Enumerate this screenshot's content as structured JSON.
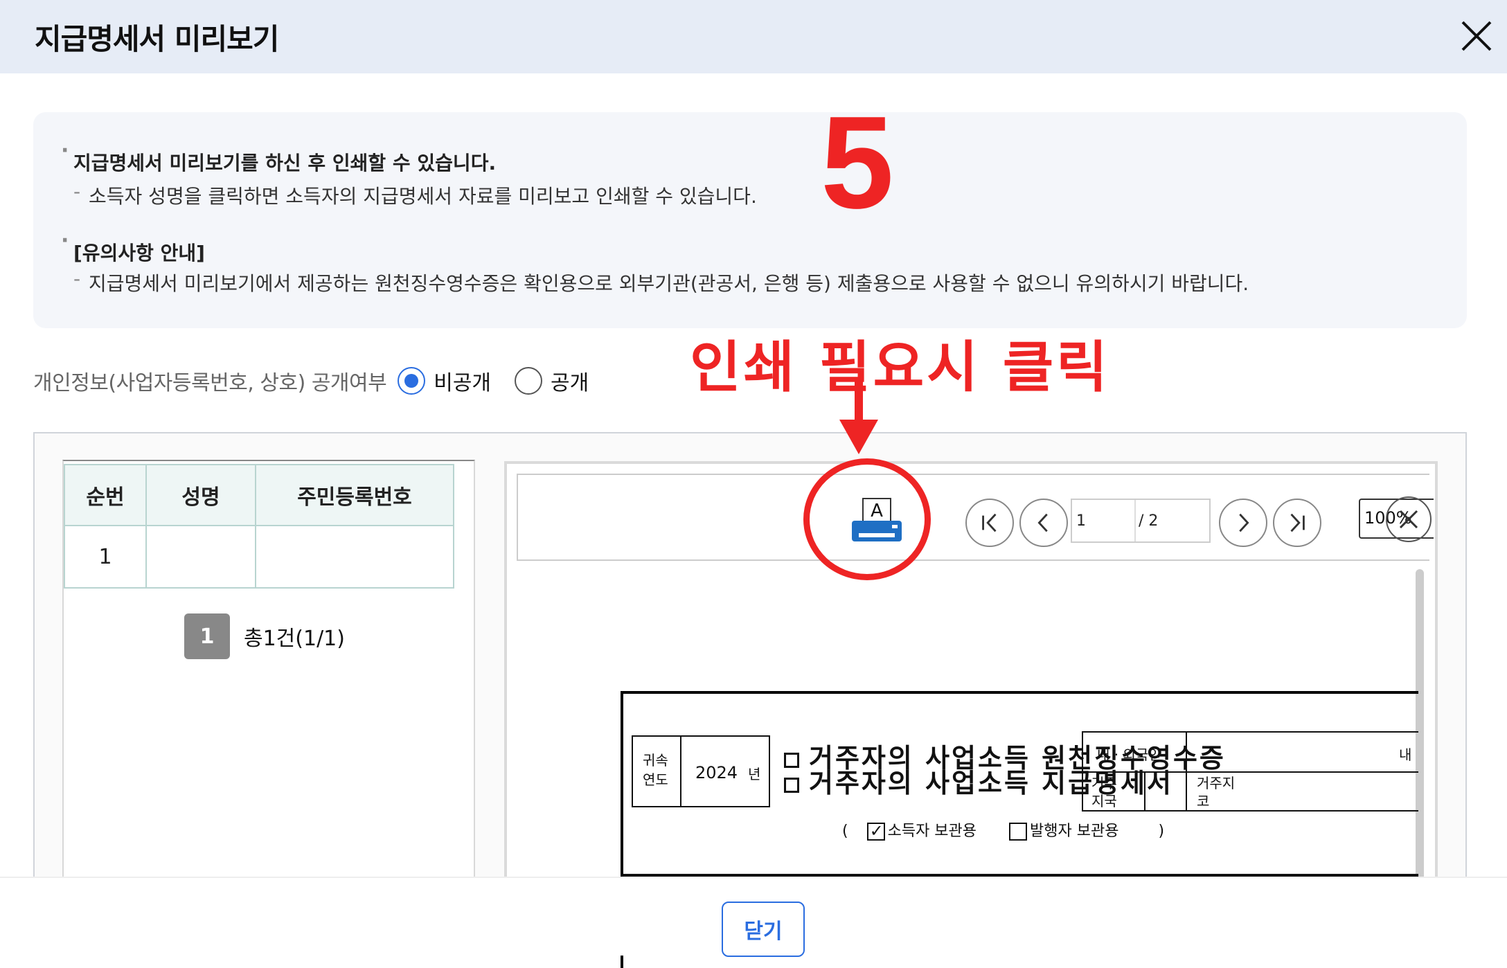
{
  "header": {
    "title": "지급명세서 미리보기",
    "close_icon": "close-icon"
  },
  "notice": {
    "bullet1": "지급명세서 미리보기를 하신 후 인쇄할 수 있습니다.",
    "bullet1_sub": "소득자 성명을 클릭하면 소득자의 지급명세서 자료를 미리보고 인쇄할 수 있습니다.",
    "bullet2": "[유의사항 안내]",
    "bullet2_sub": "지급명세서 미리보기에서 제공하는 원천징수영수증은 확인용으로 외부기관(관공서, 은행 등) 제출용으로 사용할 수 없으니 유의하시기 바랍니다."
  },
  "annotations": {
    "step_number": "5",
    "click_hint": "인쇄 필요시 클릭",
    "accent_color": "#ee2424"
  },
  "privacy": {
    "label": "개인정보(사업자등록번호, 상호) 공개여부",
    "options": [
      {
        "label": "비공개",
        "checked": true
      },
      {
        "label": "공개",
        "checked": false
      }
    ]
  },
  "employee_table": {
    "headers": [
      "순번",
      "성명",
      "주민등록번호"
    ],
    "rows": [
      {
        "no": "1",
        "name": "",
        "rrn": ""
      }
    ]
  },
  "pagination": {
    "current": "1",
    "total_label": "총1건(1/1)"
  },
  "viewer": {
    "print_icon": "printer-icon",
    "page_current": "1",
    "page_total": "/ 2",
    "zoom": "100%",
    "doc": {
      "year_label": "귀속\n연도",
      "year_value": "2024",
      "year_unit": "년",
      "title1": "거주자의 사업소득 원천징수영수증",
      "title2": "거주자의 사업소득 지급명세서",
      "copy_open": "(",
      "copy_income": "소득자 보관용",
      "copy_issuer": "발행자 보관용",
      "copy_close": ")",
      "nationality": "내 · 외국인",
      "nationality_cut": "내",
      "residence": "거주\n지국",
      "residence_code": "거주지\n코"
    }
  },
  "footer": {
    "close_button": "닫기"
  },
  "colors": {
    "header_bg": "#e6ecf6",
    "primary": "#2a6de0",
    "table_header_bg": "#eef6f5"
  }
}
